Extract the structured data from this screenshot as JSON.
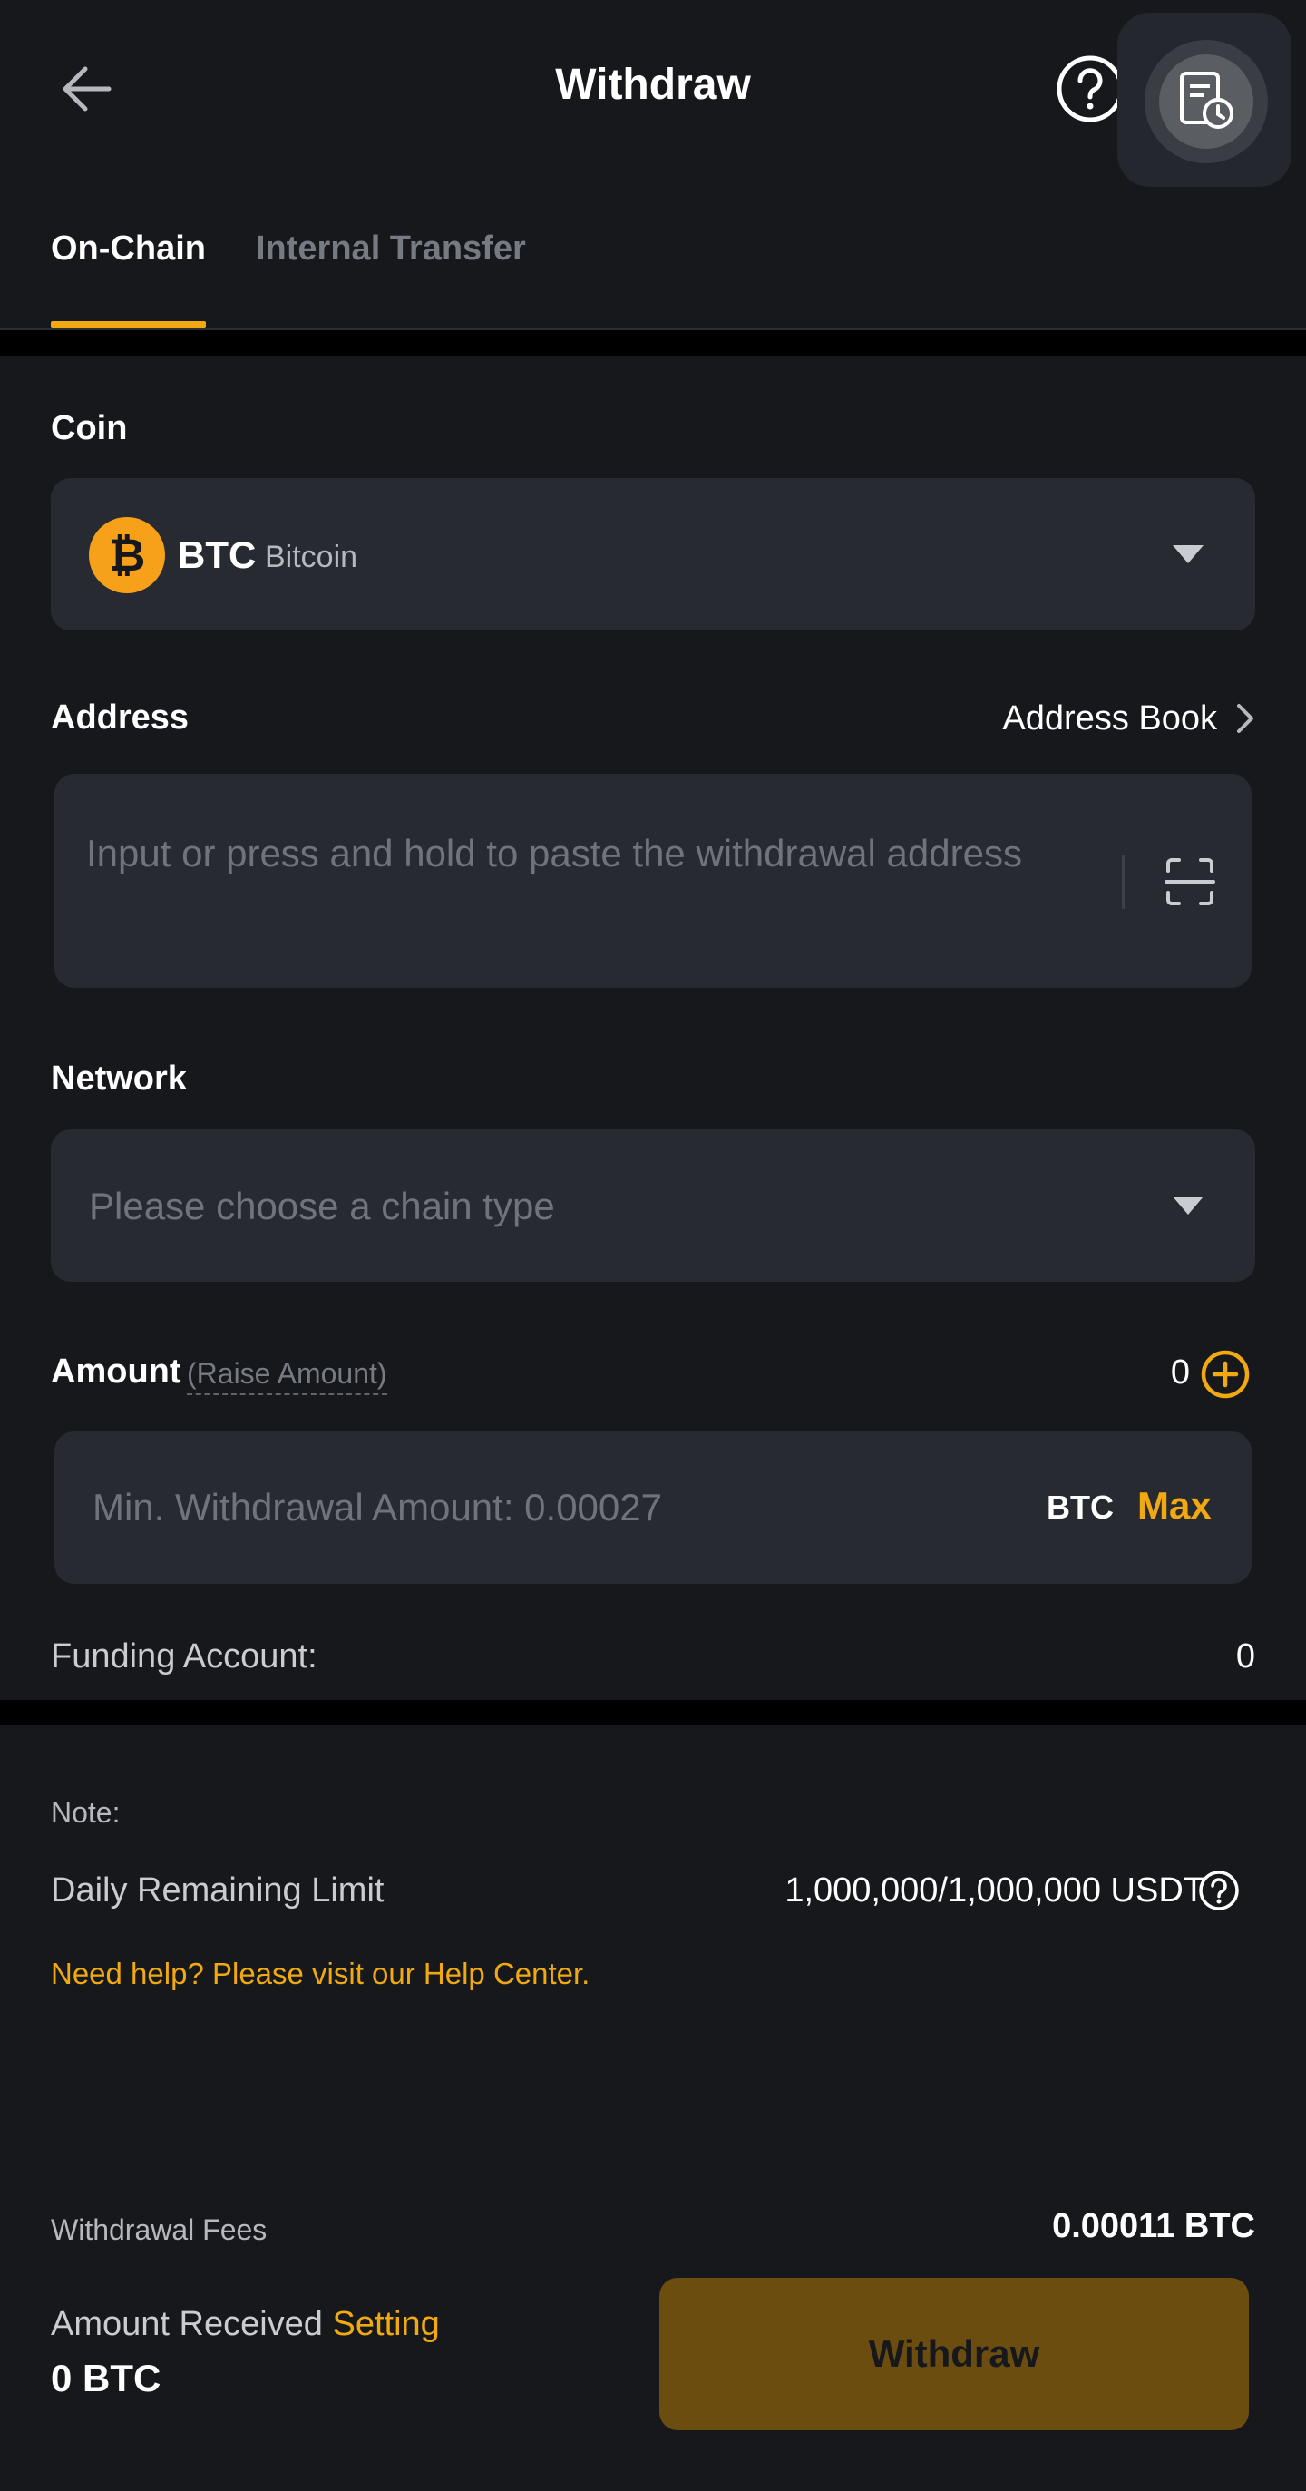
{
  "header": {
    "title": "Withdraw"
  },
  "tabs": [
    {
      "label": "On-Chain",
      "active": true
    },
    {
      "label": "Internal Transfer",
      "active": false
    }
  ],
  "coin": {
    "label": "Coin",
    "symbol": "BTC",
    "name": "Bitcoin",
    "icon_glyph": "₿"
  },
  "address": {
    "label": "Address",
    "address_book_label": "Address Book",
    "placeholder": "Input or press and hold to paste the withdrawal address"
  },
  "network": {
    "label": "Network",
    "placeholder": "Please choose a chain type"
  },
  "amount": {
    "label": "Amount",
    "raise_label": "(Raise Amount)",
    "count": "0",
    "placeholder": "Min. Withdrawal Amount: 0.00027",
    "unit": "BTC",
    "max_label": "Max"
  },
  "funding": {
    "label": "Funding Account:",
    "value": "0"
  },
  "note": {
    "label": "Note:",
    "limit_label": "Daily Remaining Limit",
    "limit_value": "1,000,000/1,000,000 USDT",
    "help_text": "Need help? Please visit our Help Center."
  },
  "summary": {
    "fees_label": "Withdrawal Fees",
    "fees_value": "0.00011 BTC",
    "received_label": "Amount Received",
    "setting_label": "Setting",
    "received_value": "0 BTC",
    "withdraw_label": "Withdraw"
  },
  "colors": {
    "background": "#17181c",
    "field": "#272a30",
    "accent": "#f0a911",
    "button_disabled": "#6b4d10"
  }
}
